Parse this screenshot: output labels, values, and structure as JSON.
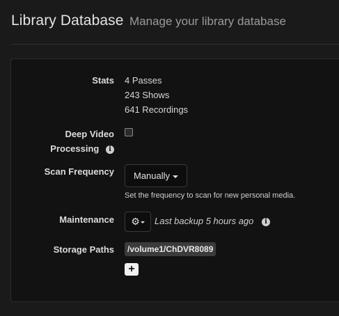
{
  "header": {
    "title": "Library Database",
    "subtitle": "Manage your library database"
  },
  "stats": {
    "label": "Stats",
    "lines": [
      "4 Passes",
      "243 Shows",
      "641 Recordings"
    ]
  },
  "deep_video": {
    "label_line1": "Deep Video",
    "label_line2": "Processing",
    "checked": false
  },
  "scan_frequency": {
    "label": "Scan Frequency",
    "selected": "Manually",
    "help": "Set the frequency to scan for new personal media."
  },
  "maintenance": {
    "label": "Maintenance",
    "status": "Last backup 5 hours ago"
  },
  "storage_paths": {
    "label": "Storage Paths",
    "paths": [
      "/volume1/ChDVR8089"
    ]
  },
  "icons": {
    "info": "info-circle-icon",
    "gear": "gear-icon",
    "add": "plus-icon"
  }
}
